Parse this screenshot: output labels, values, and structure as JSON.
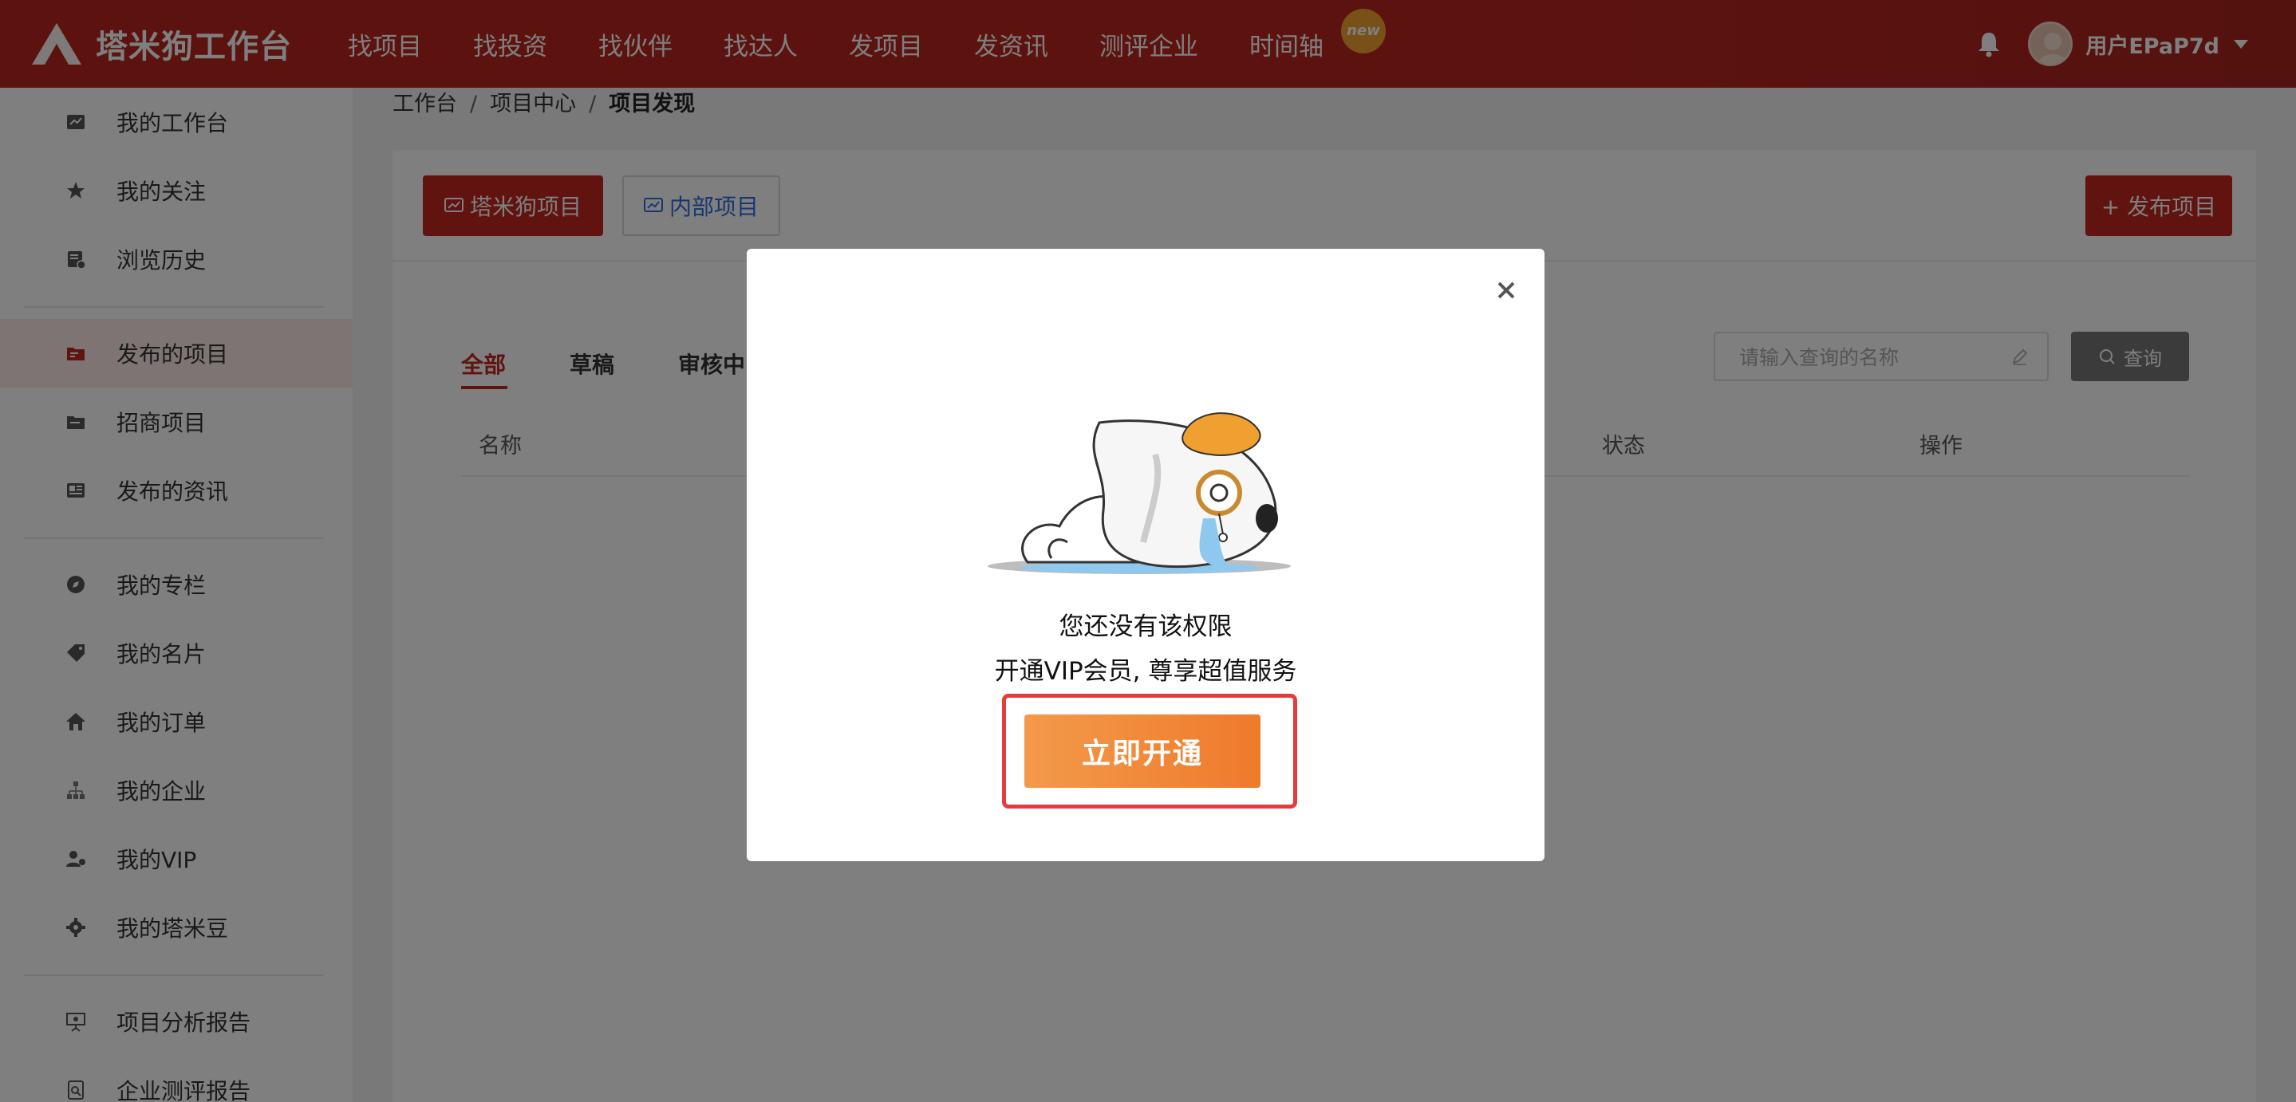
{
  "brand": {
    "name": "塔米狗工作台"
  },
  "nav": {
    "items": [
      "找项目",
      "找投资",
      "找伙伴",
      "找达人",
      "发项目",
      "发资讯",
      "测评企业",
      "时间轴"
    ],
    "new_badge": "new"
  },
  "user": {
    "name": "用户EPaP7d"
  },
  "sidebar": {
    "items": [
      {
        "label": "我的工作台",
        "icon": "dashboard-icon"
      },
      {
        "label": "我的关注",
        "icon": "star-icon"
      },
      {
        "label": "浏览历史",
        "icon": "history-icon"
      },
      {
        "label": "发布的项目",
        "icon": "folder-icon"
      },
      {
        "label": "招商项目",
        "icon": "folder-icon"
      },
      {
        "label": "发布的资讯",
        "icon": "news-icon"
      },
      {
        "label": "我的专栏",
        "icon": "compass-icon"
      },
      {
        "label": "我的名片",
        "icon": "tag-icon"
      },
      {
        "label": "我的订单",
        "icon": "home-icon"
      },
      {
        "label": "我的企业",
        "icon": "org-icon"
      },
      {
        "label": "我的VIP",
        "icon": "vip-user-icon"
      },
      {
        "label": "我的塔米豆",
        "icon": "gear-icon"
      },
      {
        "label": "项目分析报告",
        "icon": "presentation-icon"
      },
      {
        "label": "企业测评报告",
        "icon": "report-icon"
      }
    ],
    "active_index": 3
  },
  "breadcrumb": {
    "items": [
      "工作台",
      "项目中心",
      "项目发现"
    ],
    "separator": "/"
  },
  "panel": {
    "btn_tmg": "塔米狗项目",
    "btn_internal": "内部项目",
    "btn_publish": "+ 发布项目",
    "tabs": [
      "全部",
      "草稿",
      "审核中"
    ],
    "search_placeholder": "请输入查询的名称",
    "query_label": "查询",
    "columns": [
      "名称",
      "状态",
      "操作"
    ]
  },
  "modal": {
    "line1": "您还没有该权限",
    "line2": "开通VIP会员, 尊享超值服务",
    "cta": "立即开通"
  },
  "colors": {
    "primary": "#c0271f",
    "cta": "#f0892f",
    "highlight": "#e63b3b"
  }
}
